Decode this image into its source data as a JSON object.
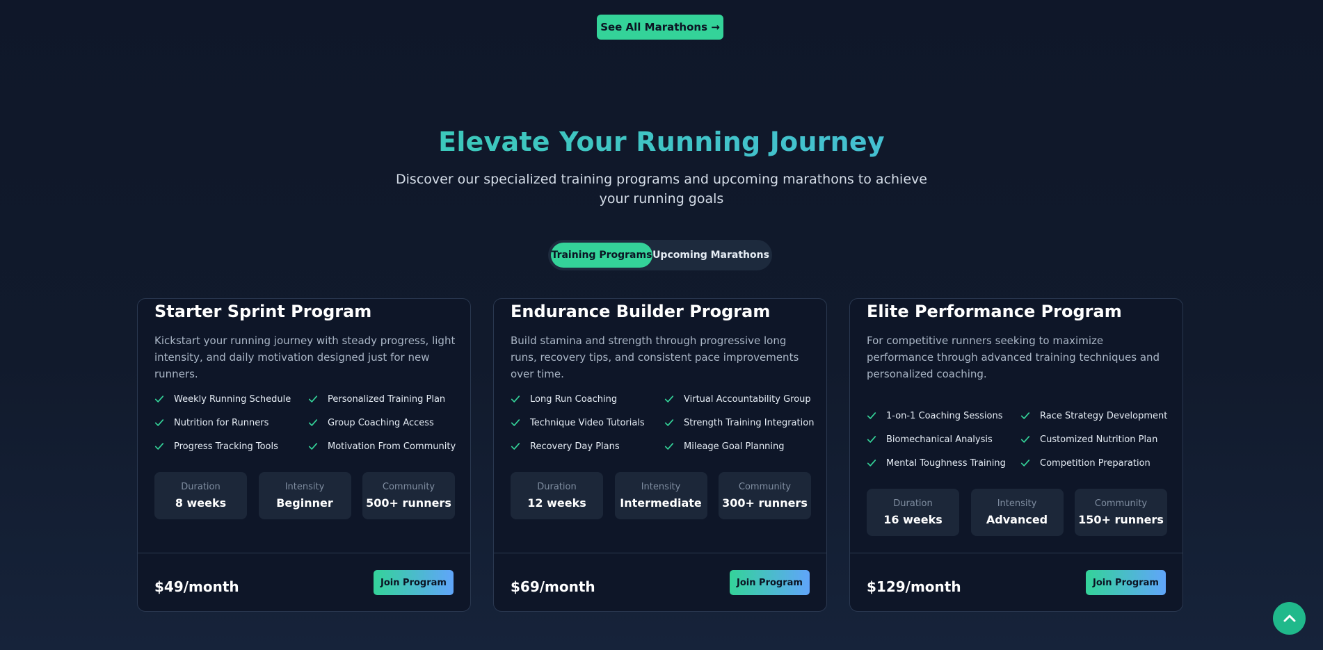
{
  "header": {
    "see_all_label": "See All Marathons →"
  },
  "section": {
    "title": "Elevate Your Running Journey",
    "subtitle": "Discover our specialized training programs and upcoming marathons to achieve your running goals"
  },
  "tabs": [
    {
      "label": "Training Programs",
      "active": true
    },
    {
      "label": "Upcoming Marathons",
      "active": false
    }
  ],
  "colors": {
    "accent": "#34d399",
    "accent_blue": "#60a5fa",
    "background": "#0f1729",
    "card": "#0e1628"
  },
  "programs": [
    {
      "title": "Starter Sprint Program",
      "description": "Kickstart your running journey with steady progress, light intensity, and daily motivation designed just for new runners.",
      "features": [
        "Weekly Running Schedule",
        "Personalized Training Plan",
        "Nutrition for Runners",
        "Group Coaching Access",
        "Progress Tracking Tools",
        "Motivation From Community"
      ],
      "stats": [
        {
          "label": "Duration",
          "value": "8 weeks"
        },
        {
          "label": "Intensity",
          "value": "Beginner"
        },
        {
          "label": "Community",
          "value": "500+ runners"
        }
      ],
      "price": "$49/month",
      "cta": "Join Program"
    },
    {
      "title": "Endurance Builder Program",
      "description": "Build stamina and strength through progressive long runs, recovery tips, and consistent pace improvements over time.",
      "features": [
        "Long Run Coaching",
        "Virtual Accountability Group",
        "Technique Video Tutorials",
        "Strength Training Integration",
        "Recovery Day Plans",
        "Mileage Goal Planning"
      ],
      "stats": [
        {
          "label": "Duration",
          "value": "12 weeks"
        },
        {
          "label": "Intensity",
          "value": "Intermediate"
        },
        {
          "label": "Community",
          "value": "300+ runners"
        }
      ],
      "price": "$69/month",
      "cta": "Join Program"
    },
    {
      "title": "Elite Performance Program",
      "description": "For competitive runners seeking to maximize performance through advanced training techniques and personalized coaching.",
      "features": [
        "1-on-1 Coaching Sessions",
        "Race Strategy Development",
        "Biomechanical Analysis",
        "Customized Nutrition Plan",
        "Mental Toughness Training",
        "Competition Preparation"
      ],
      "stats": [
        {
          "label": "Duration",
          "value": "16 weeks"
        },
        {
          "label": "Intensity",
          "value": "Advanced"
        },
        {
          "label": "Community",
          "value": "150+ runners"
        }
      ],
      "price": "$129/month",
      "cta": "Join Program"
    }
  ],
  "icons": {
    "feature": "check-icon",
    "scroll": "chevron-up-icon"
  }
}
